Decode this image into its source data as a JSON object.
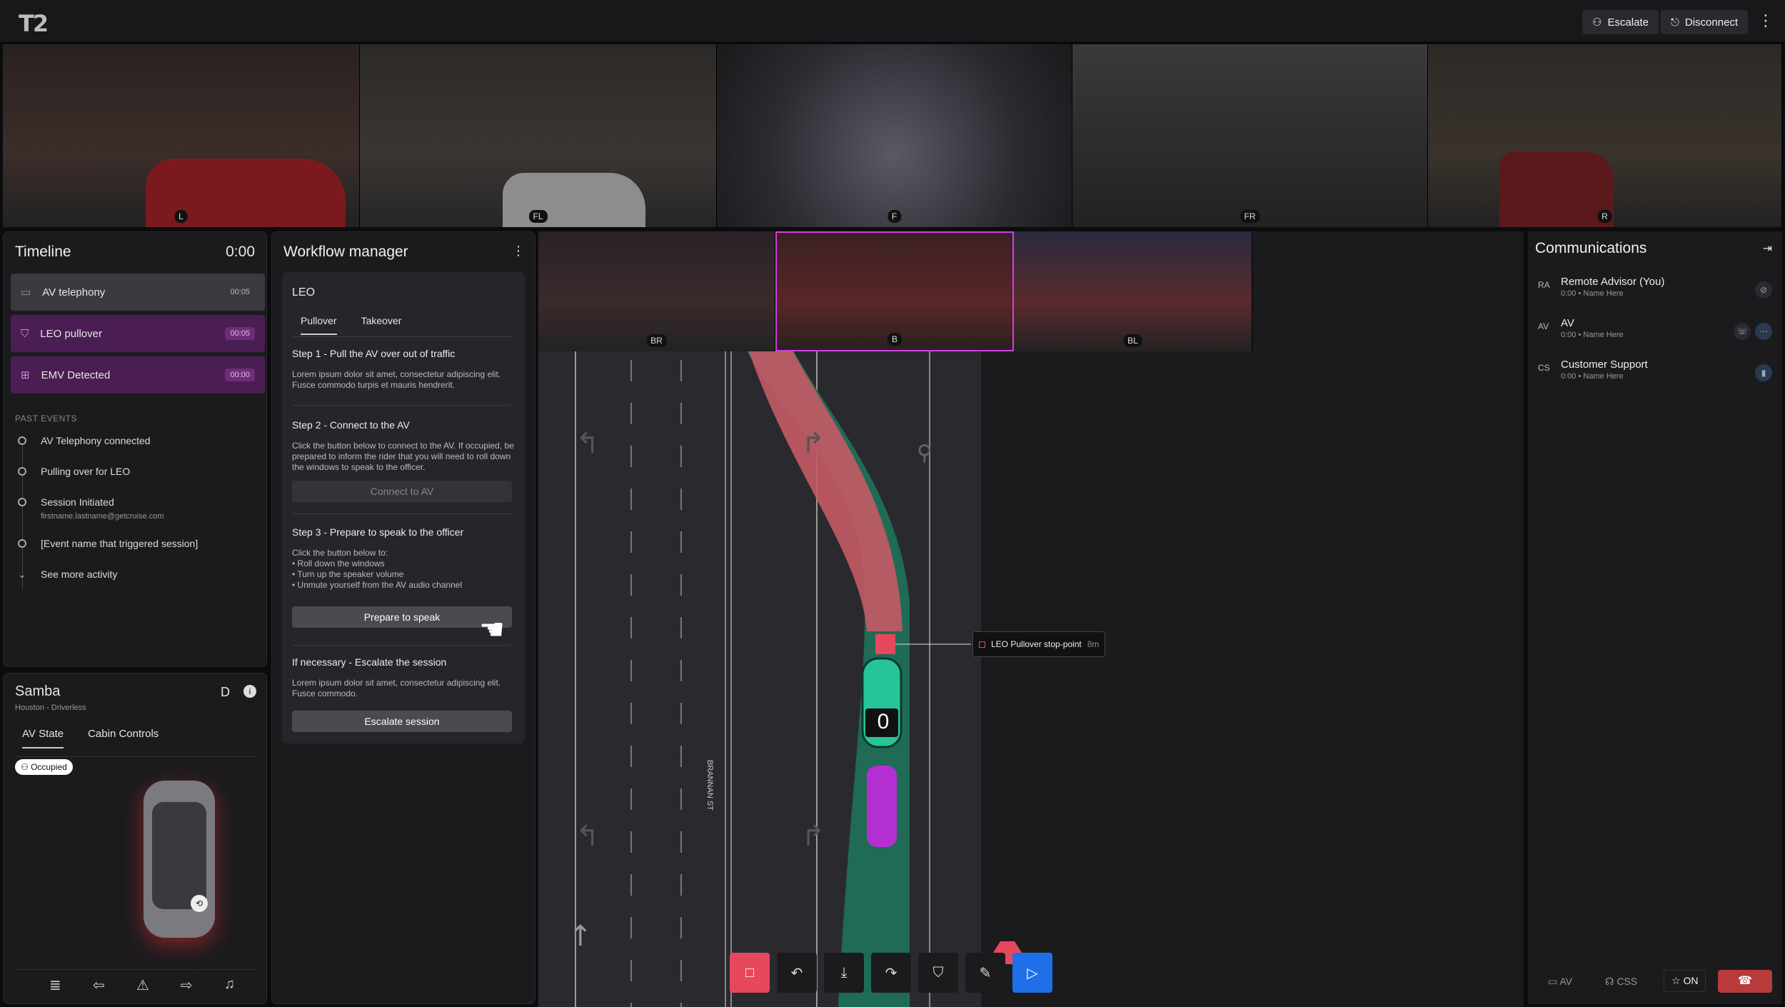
{
  "topbar": {
    "logo": "T2",
    "escalate": "Escalate",
    "disconnect": "Disconnect"
  },
  "cameras": {
    "top": [
      "L",
      "FL",
      "F",
      "FR",
      "R"
    ],
    "rear": [
      "BR",
      "B",
      "BL"
    ]
  },
  "timeline": {
    "title": "Timeline",
    "clock": "0:00",
    "active": [
      {
        "label": "AV telephony",
        "time": "00:05"
      },
      {
        "label": "LEO pullover",
        "time": "00:05"
      },
      {
        "label": "EMV Detected",
        "time": "00:00"
      }
    ],
    "past_heading": "PAST EVENTS",
    "events": [
      {
        "label": "AV Telephony connected",
        "sub": ""
      },
      {
        "label": "Pulling over for LEO",
        "sub": ""
      },
      {
        "label": "Session Initiated",
        "sub": "firstname.lastname@getcruise.com"
      },
      {
        "label": "[Event name that triggered session]",
        "sub": ""
      }
    ],
    "more": "See more activity"
  },
  "vehicle": {
    "name": "Samba",
    "location": "Houston - Driverless",
    "gear": "D",
    "tabs": [
      "AV State",
      "Cabin Controls"
    ],
    "badge": "Occupied"
  },
  "workflow": {
    "title": "Workflow manager",
    "section": "LEO",
    "tabs": [
      "Pullover",
      "Takeover"
    ],
    "step1": {
      "title": "Step 1 - Pull the AV over out of traffic",
      "body": "Lorem ipsum dolor sit amet, consectetur adipiscing elit. Fusce commodo turpis et mauris hendrerit."
    },
    "step2": {
      "title": "Step 2 - Connect to the AV",
      "body": "Click the button below to connect to the AV. If occupied, be prepared to inform the rider that you will need to roll down the windows to speak to the officer.",
      "button": "Connect to AV"
    },
    "step3": {
      "title": "Step 3 - Prepare to speak to the officer",
      "intro": "Click the button below to:",
      "bullets": [
        "Roll down the windows",
        "Turn up the speaker volume",
        "Unmute yourself from the AV audio channel"
      ],
      "button": "Prepare to speak"
    },
    "step4": {
      "title": "If necessary - Escalate the session",
      "body": "Lorem ipsum dolor sit amet, consectetur adipiscing elit. Fusce commodo.",
      "button": "Escalate session"
    }
  },
  "map": {
    "stop_label": "LEO Pullover stop-point",
    "stop_dist": "8m",
    "speed": "0",
    "street": "BRANNAN ST"
  },
  "comms": {
    "title": "Communications",
    "people": [
      {
        "abbr": "RA",
        "name": "Remote Advisor (You)",
        "sub": "0:00 • Name Here"
      },
      {
        "abbr": "AV",
        "name": "AV",
        "sub": "0:00 • Name Here"
      },
      {
        "abbr": "CS",
        "name": "Customer Support",
        "sub": "0:00 • Name Here"
      }
    ],
    "bottom": {
      "av": "AV",
      "css": "CSS",
      "on": "ON"
    }
  },
  "colors": {
    "accent_red": "#e8485d",
    "accent_blue": "#1f6fe8",
    "path_green": "#1f6b55",
    "path_red": "#c45a65",
    "purple": "#4a1e52"
  }
}
